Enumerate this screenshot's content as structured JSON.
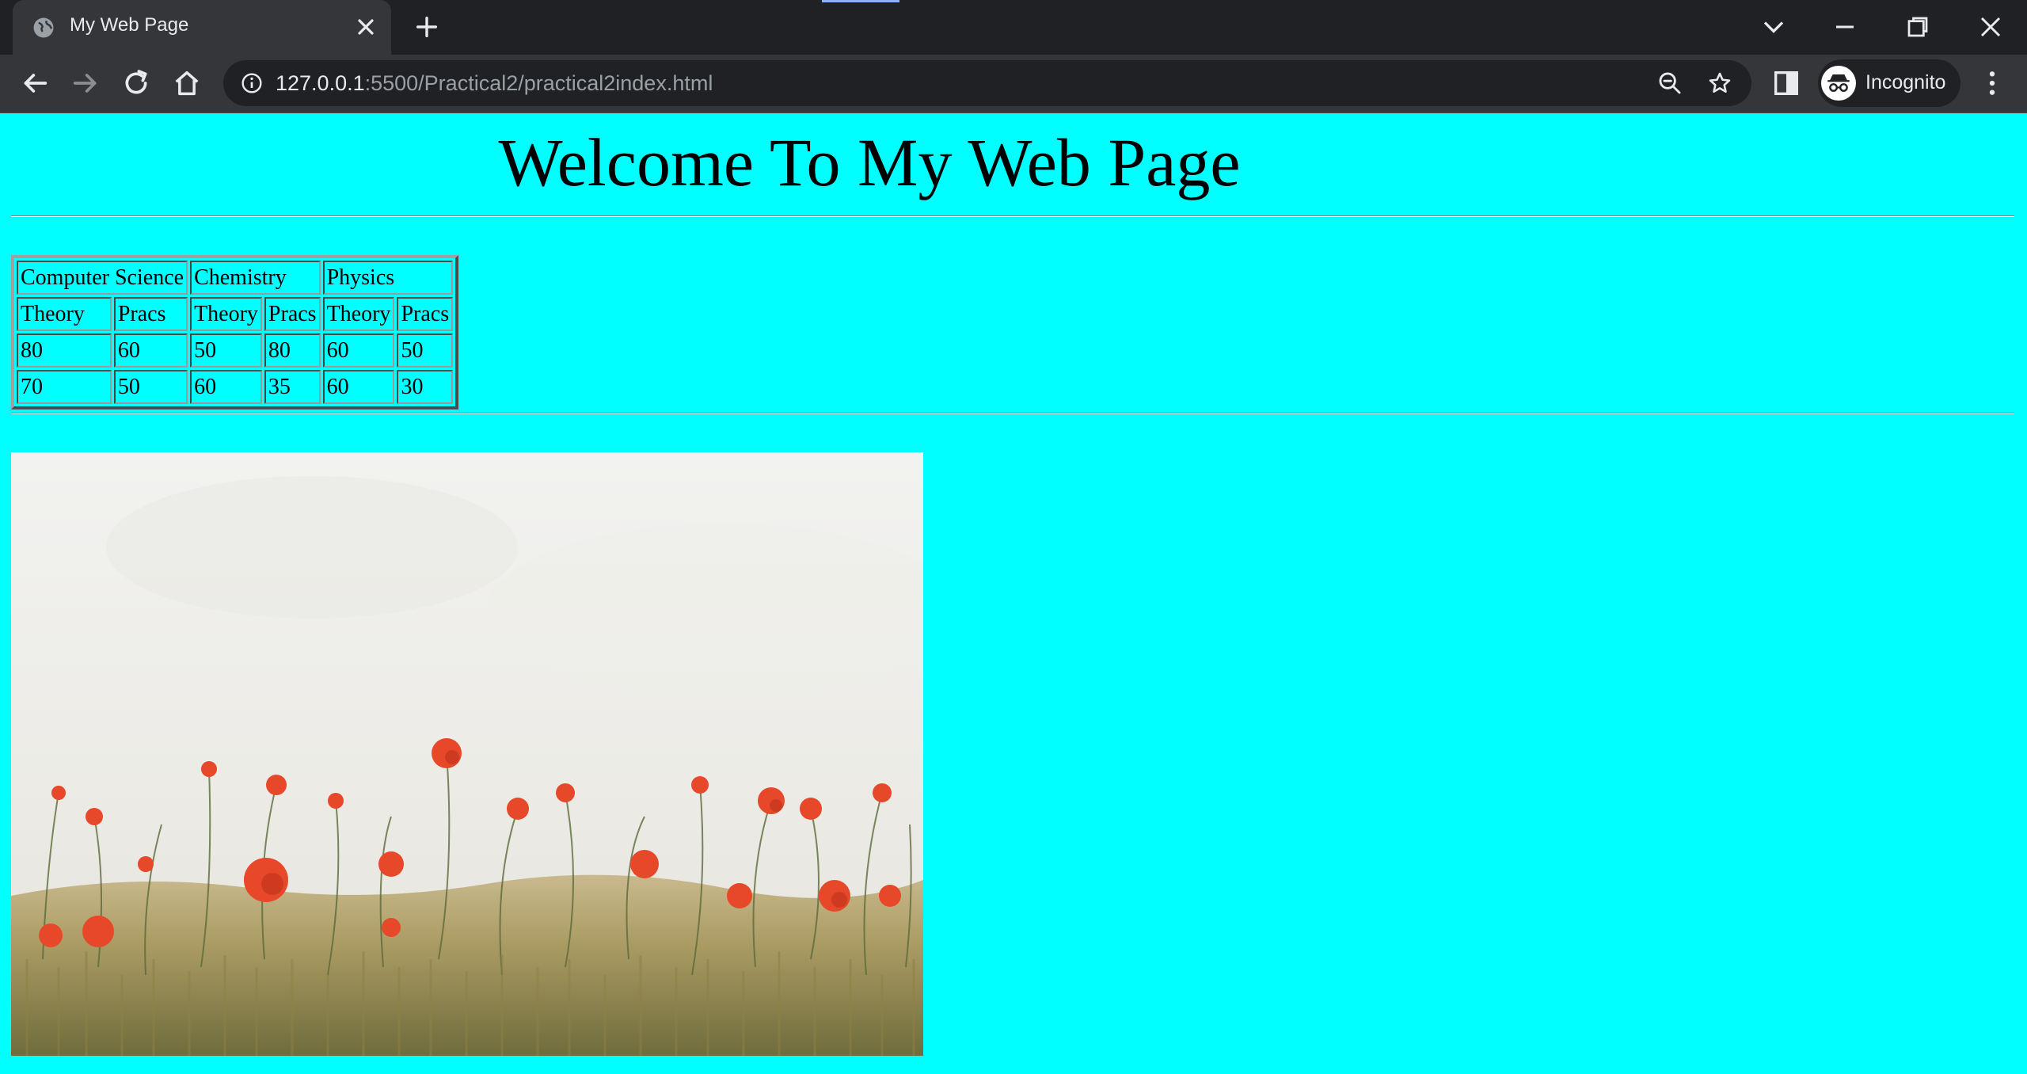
{
  "browser": {
    "tab_title": "My Web Page",
    "url_host": "127.0.0.1",
    "url_rest": ":5500/Practical2/practical2index.html",
    "profile_label": "Incognito",
    "icons": [
      "globe-icon",
      "close-icon",
      "plus-icon",
      "chevron-down-icon",
      "minimize-icon",
      "restore-icon",
      "window-close-icon",
      "back-icon",
      "forward-icon",
      "reload-icon",
      "home-icon",
      "info-icon",
      "zoom-out-icon",
      "star-icon",
      "side-panel-icon",
      "incognito-icon",
      "menu-icon"
    ],
    "colors": {
      "tabstrip": "#202124",
      "toolbar": "#35363a",
      "text": "#e8eaed"
    }
  },
  "page": {
    "heading": "Welcome To My Web Page",
    "background": "#00ffff",
    "table": {
      "subjects": [
        "Computer Science",
        "Chemistry",
        "Physics"
      ],
      "subheaders": [
        "Theory",
        "Pracs",
        "Theory",
        "Pracs",
        "Theory",
        "Pracs"
      ],
      "rows": [
        [
          "80",
          "60",
          "50",
          "80",
          "60",
          "50"
        ],
        [
          "70",
          "50",
          "60",
          "35",
          "60",
          "30"
        ]
      ]
    },
    "image": {
      "subject": "poppy-field-photo"
    }
  }
}
